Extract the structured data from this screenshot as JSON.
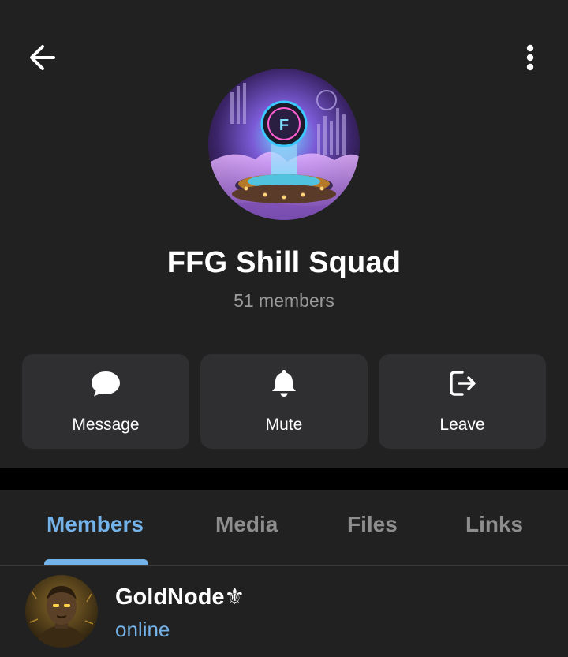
{
  "header": {
    "back_icon": "arrow-left-icon",
    "more_icon": "kebab-menu-icon"
  },
  "group": {
    "name": "FFG Shill Squad",
    "member_count": "51 members"
  },
  "actions": [
    {
      "label": "Message",
      "icon": "chat-bubble-icon"
    },
    {
      "label": "Mute",
      "icon": "bell-icon"
    },
    {
      "label": "Leave",
      "icon": "leave-icon"
    }
  ],
  "tabs": [
    {
      "label": "Members",
      "active": true
    },
    {
      "label": "Media",
      "active": false
    },
    {
      "label": "Files",
      "active": false
    },
    {
      "label": "Links",
      "active": false
    }
  ],
  "members": [
    {
      "name": "GoldNode⚜",
      "status": "online"
    }
  ],
  "colors": {
    "background": "#212121",
    "card": "#2f2f32",
    "accent": "#74b3e9",
    "muted_text": "#9a9a9a"
  }
}
